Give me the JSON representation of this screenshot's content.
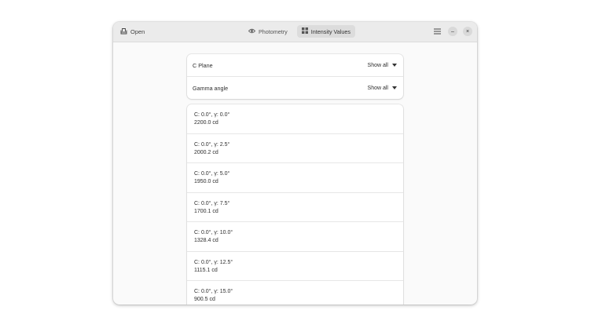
{
  "header": {
    "open_label": "Open",
    "tabs": [
      {
        "label": "Photometry",
        "icon": "eye-icon",
        "active": false
      },
      {
        "label": "Intensity Values",
        "icon": "grid-icon",
        "active": true
      }
    ],
    "menu_icon": "hamburger-menu-icon",
    "minimize_symbol": "–",
    "close_symbol": "×"
  },
  "filters": [
    {
      "label": "C Plane",
      "value": "Show all"
    },
    {
      "label": "Gamma angle",
      "value": "Show all"
    }
  ],
  "values": [
    {
      "title": "C: 0.0°, γ: 0.0°",
      "intensity": "2200.0 cd"
    },
    {
      "title": "C: 0.0°, γ: 2.5°",
      "intensity": "2000.2 cd"
    },
    {
      "title": "C: 0.0°, γ: 5.0°",
      "intensity": "1950.0 cd"
    },
    {
      "title": "C: 0.0°, γ: 7.5°",
      "intensity": "1700.1 cd"
    },
    {
      "title": "C: 0.0°, γ: 10.0°",
      "intensity": "1328.4 cd"
    },
    {
      "title": "C: 0.0°, γ: 12.5°",
      "intensity": "1115.1 cd"
    },
    {
      "title": "C: 0.0°, γ: 15.0°",
      "intensity": "900.5 cd"
    }
  ],
  "colors": {
    "headerbar": "#ebebeb",
    "window_bg": "#fafafa",
    "active_tab": "#dcdcdc"
  }
}
